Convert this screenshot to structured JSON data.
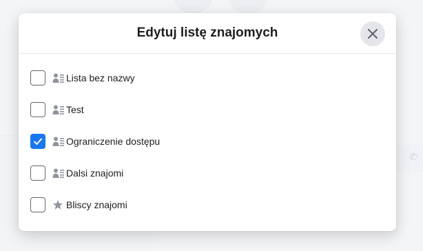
{
  "dialog": {
    "title": "Edytuj listę znajomych",
    "close_label": "Zamknij"
  },
  "lists": [
    {
      "label": "Lista bez nazwy",
      "checked": false,
      "icon": "friend-list-icon"
    },
    {
      "label": "Test",
      "checked": false,
      "icon": "friend-list-icon"
    },
    {
      "label": "Ograniczenie dostępu",
      "checked": true,
      "icon": "friend-list-icon"
    },
    {
      "label": "Dalsi znajomi",
      "checked": false,
      "icon": "friend-list-icon"
    },
    {
      "label": "Bliscy znajomi",
      "checked": false,
      "icon": "star-icon"
    }
  ],
  "colors": {
    "accent": "#1877f2",
    "icon_gray": "#90949c"
  }
}
